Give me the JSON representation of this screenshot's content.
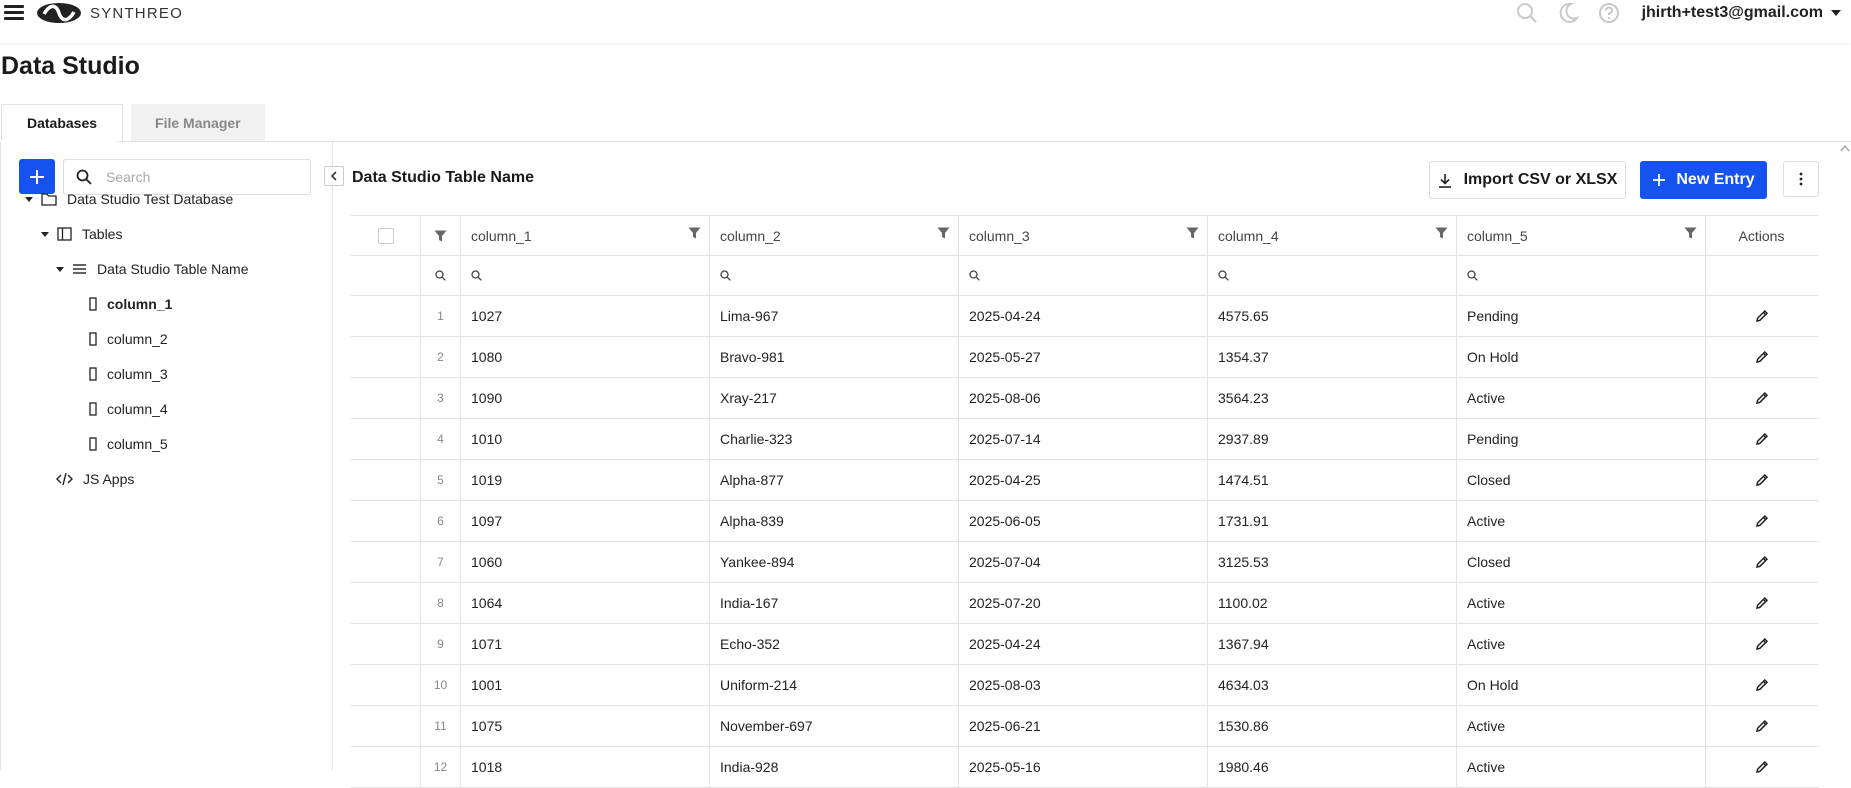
{
  "app": {
    "brand": "SYNTHREO",
    "user": "jhirth+test3@gmail.com",
    "icons": [
      "search-icon",
      "moon-icon",
      "help-icon"
    ]
  },
  "page": {
    "title": "Data Studio",
    "tabs": [
      {
        "label": "Databases",
        "active": true
      },
      {
        "label": "File Manager",
        "active": false
      }
    ]
  },
  "sidebar": {
    "search_placeholder": "Search",
    "tree": {
      "database": "Data Studio Test Database",
      "tables_label": "Tables",
      "table": "Data Studio Table Name",
      "columns": [
        "column_1",
        "column_2",
        "column_3",
        "column_4",
        "column_5"
      ],
      "selected_column": "column_1",
      "js_apps": "JS Apps"
    }
  },
  "main": {
    "table_name": "Data Studio Table Name",
    "import_label": "Import CSV or XLSX",
    "new_entry_label": "New Entry",
    "columns": [
      "column_1",
      "column_2",
      "column_3",
      "column_4",
      "column_5"
    ],
    "actions_label": "Actions",
    "rows": [
      {
        "n": "1",
        "cells": [
          "1027",
          "Lima-967",
          "2025-04-24",
          "4575.65",
          "Pending"
        ]
      },
      {
        "n": "2",
        "cells": [
          "1080",
          "Bravo-981",
          "2025-05-27",
          "1354.37",
          "On Hold"
        ]
      },
      {
        "n": "3",
        "cells": [
          "1090",
          "Xray-217",
          "2025-08-06",
          "3564.23",
          "Active"
        ]
      },
      {
        "n": "4",
        "cells": [
          "1010",
          "Charlie-323",
          "2025-07-14",
          "2937.89",
          "Pending"
        ]
      },
      {
        "n": "5",
        "cells": [
          "1019",
          "Alpha-877",
          "2025-04-25",
          "1474.51",
          "Closed"
        ]
      },
      {
        "n": "6",
        "cells": [
          "1097",
          "Alpha-839",
          "2025-06-05",
          "1731.91",
          "Active"
        ]
      },
      {
        "n": "7",
        "cells": [
          "1060",
          "Yankee-894",
          "2025-07-04",
          "3125.53",
          "Closed"
        ]
      },
      {
        "n": "8",
        "cells": [
          "1064",
          "India-167",
          "2025-07-20",
          "1100.02",
          "Active"
        ]
      },
      {
        "n": "9",
        "cells": [
          "1071",
          "Echo-352",
          "2025-04-24",
          "1367.94",
          "Active"
        ]
      },
      {
        "n": "10",
        "cells": [
          "1001",
          "Uniform-214",
          "2025-08-03",
          "4634.03",
          "On Hold"
        ]
      },
      {
        "n": "11",
        "cells": [
          "1075",
          "November-697",
          "2025-06-21",
          "1530.86",
          "Active"
        ]
      },
      {
        "n": "12",
        "cells": [
          "1018",
          "India-928",
          "2025-05-16",
          "1980.46",
          "Active"
        ]
      }
    ]
  },
  "colors": {
    "primary": "#1652f0",
    "border": "#e3e3e3",
    "tab_inactive_bg": "#f1f1f1"
  }
}
